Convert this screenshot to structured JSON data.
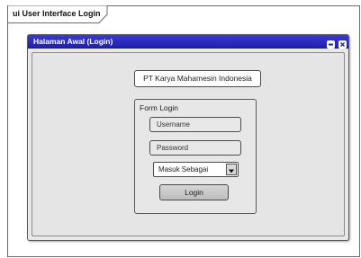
{
  "diagram": {
    "frame_label": "ui User Interface Login"
  },
  "window": {
    "title": "Halaman Awal (Login)",
    "minimize_icon": "minimize-icon",
    "close_icon": "close-icon",
    "title_bar_color": "#2a2ac4"
  },
  "content": {
    "company_name": "PT Karya Mahamesin Indonesia",
    "form": {
      "title": "Form Login",
      "username_placeholder": "Username",
      "password_placeholder": "Password",
      "role_select_value": "Masuk Sebagai",
      "login_button_label": "Login"
    }
  }
}
